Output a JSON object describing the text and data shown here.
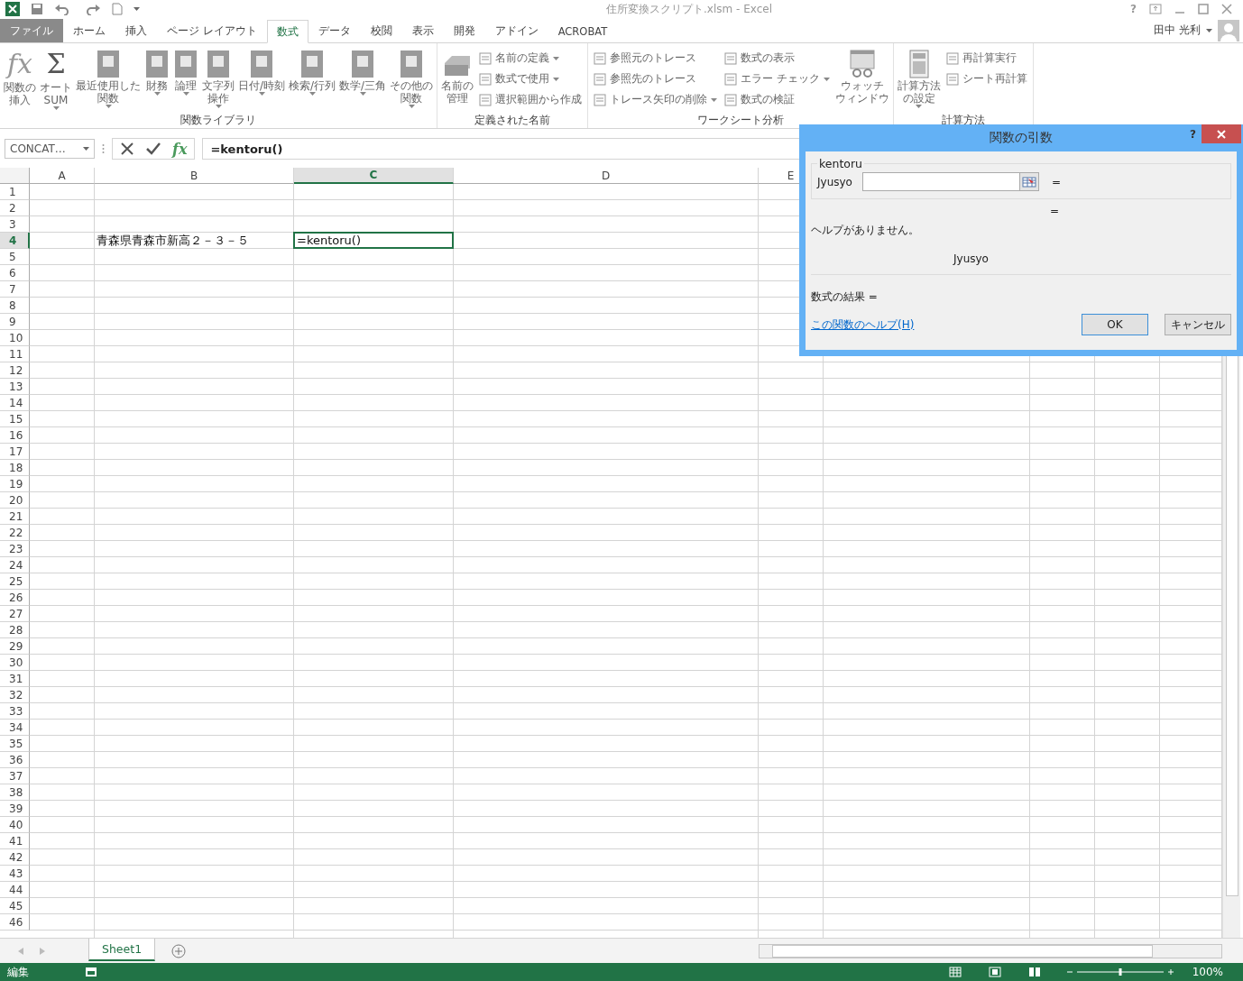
{
  "window": {
    "title": "住所変換スクリプト.xlsm - Excel",
    "help": "?"
  },
  "tabs": [
    {
      "label": "ファイル",
      "kind": "file",
      "selected": false
    },
    {
      "label": "ホーム",
      "kind": "tab",
      "selected": false
    },
    {
      "label": "挿入",
      "kind": "tab",
      "selected": false
    },
    {
      "label": "ページ レイアウト",
      "kind": "tab",
      "selected": false
    },
    {
      "label": "数式",
      "kind": "tab",
      "selected": true
    },
    {
      "label": "データ",
      "kind": "tab",
      "selected": false
    },
    {
      "label": "校閲",
      "kind": "tab",
      "selected": false
    },
    {
      "label": "表示",
      "kind": "tab",
      "selected": false
    },
    {
      "label": "開発",
      "kind": "tab",
      "selected": false
    },
    {
      "label": "アドイン",
      "kind": "tab",
      "selected": false
    },
    {
      "label": "ACROBAT",
      "kind": "tab",
      "selected": false
    }
  ],
  "user": {
    "name": "田中 光利"
  },
  "ribbon": {
    "groups": [
      {
        "label": "関数ライブラリ",
        "items": [
          {
            "kind": "glyph",
            "glyph": "fx",
            "lines": [
              "関数の",
              "挿入"
            ],
            "dropdown": false
          },
          {
            "kind": "glyph",
            "glyph": "Σ",
            "lines": [
              "オート",
              "SUM"
            ],
            "dropdown": true
          },
          {
            "kind": "book",
            "lines": [
              "最近使用した",
              "関数"
            ],
            "dropdown": true
          },
          {
            "kind": "book",
            "lines": [
              "財務"
            ],
            "dropdown": true
          },
          {
            "kind": "book",
            "lines": [
              "論理"
            ],
            "dropdown": true
          },
          {
            "kind": "book",
            "lines": [
              "文字列",
              "操作"
            ],
            "dropdown": true
          },
          {
            "kind": "book",
            "lines": [
              "日付/時刻"
            ],
            "dropdown": true
          },
          {
            "kind": "book",
            "lines": [
              "検索/行列"
            ],
            "dropdown": true
          },
          {
            "kind": "book",
            "lines": [
              "数学/三角"
            ],
            "dropdown": true
          },
          {
            "kind": "book",
            "lines": [
              "その他の",
              "関数"
            ],
            "dropdown": true
          }
        ]
      },
      {
        "label": "定義された名前",
        "items": [
          {
            "kind": "tray",
            "lines": [
              "名前の",
              "管理"
            ],
            "dropdown": false
          },
          {
            "kind": "small",
            "label": "名前の定義",
            "dropdown": true
          },
          {
            "kind": "small",
            "label": "数式で使用",
            "dropdown": true
          },
          {
            "kind": "small",
            "label": "選択範囲から作成",
            "dropdown": false
          }
        ]
      },
      {
        "label": "ワークシート分析",
        "items": [
          {
            "kind": "small",
            "label": "参照元のトレース",
            "dropdown": false
          },
          {
            "kind": "small",
            "label": "参照先のトレース",
            "dropdown": false
          },
          {
            "kind": "small",
            "label": "トレース矢印の削除",
            "dropdown": true
          },
          {
            "kind": "small",
            "label": "数式の表示",
            "dropdown": false
          },
          {
            "kind": "small",
            "label": "エラー チェック",
            "dropdown": true
          },
          {
            "kind": "small",
            "label": "数式の検証",
            "dropdown": false
          },
          {
            "kind": "watch",
            "lines": [
              "ウォッチ",
              "ウィンドウ"
            ],
            "dropdown": false
          }
        ]
      },
      {
        "label": "計算方法",
        "items": [
          {
            "kind": "calculator",
            "lines": [
              "計算方法",
              "の設定"
            ],
            "dropdown": true
          },
          {
            "kind": "small",
            "label": "再計算実行",
            "dropdown": false
          },
          {
            "kind": "small",
            "label": "シート再計算",
            "dropdown": false
          }
        ]
      }
    ]
  },
  "formula_bar": {
    "name_box": "CONCAT…",
    "fx": "fx",
    "formula": "=kentoru()"
  },
  "grid": {
    "columns": [
      {
        "label": "A",
        "selected": false
      },
      {
        "label": "B",
        "selected": false
      },
      {
        "label": "C",
        "selected": true
      },
      {
        "label": "D",
        "selected": false
      },
      {
        "label": "E",
        "selected": false
      }
    ],
    "rows": [
      {
        "label": "1",
        "selected": false
      },
      {
        "label": "2",
        "selected": false
      },
      {
        "label": "3",
        "selected": false
      },
      {
        "label": "4",
        "selected": true,
        "cells": [
          null,
          {
            "text": "青森県青森市新高２－３－５",
            "active": false
          },
          {
            "text": "=kentoru()",
            "active": true
          }
        ]
      },
      {
        "label": "5",
        "selected": false
      },
      {
        "label": "6",
        "selected": false
      },
      {
        "label": "7",
        "selected": false
      },
      {
        "label": "8",
        "selected": false
      },
      {
        "label": "9",
        "selected": false
      },
      {
        "label": "10",
        "selected": false
      },
      {
        "label": "11",
        "selected": false
      },
      {
        "label": "12",
        "selected": false
      },
      {
        "label": "13",
        "selected": false
      },
      {
        "label": "14",
        "selected": false
      },
      {
        "label": "15",
        "selected": false
      },
      {
        "label": "16",
        "selected": false
      },
      {
        "label": "17",
        "selected": false
      },
      {
        "label": "18",
        "selected": false
      },
      {
        "label": "19",
        "selected": false
      },
      {
        "label": "20",
        "selected": false
      },
      {
        "label": "21",
        "selected": false
      },
      {
        "label": "22",
        "selected": false
      },
      {
        "label": "23",
        "selected": false
      },
      {
        "label": "24",
        "selected": false
      },
      {
        "label": "25",
        "selected": false
      },
      {
        "label": "26",
        "selected": false
      },
      {
        "label": "27",
        "selected": false
      },
      {
        "label": "28",
        "selected": false
      },
      {
        "label": "29",
        "selected": false
      },
      {
        "label": "30",
        "selected": false
      },
      {
        "label": "31",
        "selected": false
      },
      {
        "label": "32",
        "selected": false
      },
      {
        "label": "33",
        "selected": false
      },
      {
        "label": "34",
        "selected": false
      },
      {
        "label": "35",
        "selected": false
      },
      {
        "label": "36",
        "selected": false
      },
      {
        "label": "37",
        "selected": false
      },
      {
        "label": "38",
        "selected": false
      },
      {
        "label": "39",
        "selected": false
      },
      {
        "label": "40",
        "selected": false
      },
      {
        "label": "41",
        "selected": false
      },
      {
        "label": "42",
        "selected": false
      },
      {
        "label": "43",
        "selected": false
      },
      {
        "label": "44",
        "selected": false
      },
      {
        "label": "45",
        "selected": false
      },
      {
        "label": "46",
        "selected": false
      }
    ]
  },
  "sheet_tabs": [
    {
      "label": "Sheet1",
      "selected": true
    }
  ],
  "status_bar": {
    "mode": "編集",
    "zoom": "100%",
    "zoom_slider": {
      "level": 0.5
    }
  },
  "dialog": {
    "title": "関数の引数",
    "help": "?",
    "function_name": "kentoru",
    "arguments": [
      {
        "label": "Jyusyo",
        "equals": "="
      }
    ],
    "function_equals": "=",
    "description": "ヘルプがありません。",
    "argument_help": "Jyusyo",
    "result": "数式の結果 =",
    "help_link": "この関数のヘルプ(H)",
    "buttons": [
      {
        "label": "OK",
        "kind": "default"
      },
      {
        "label": "キャンセル",
        "kind": "normal"
      }
    ]
  }
}
